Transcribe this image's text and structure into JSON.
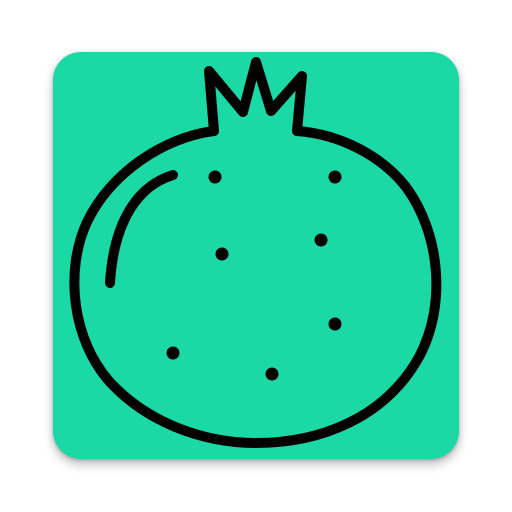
{
  "app_icon": {
    "icon": "pomegranate-icon",
    "background_color": "#1ad9a5",
    "stroke_color": "#000000"
  }
}
